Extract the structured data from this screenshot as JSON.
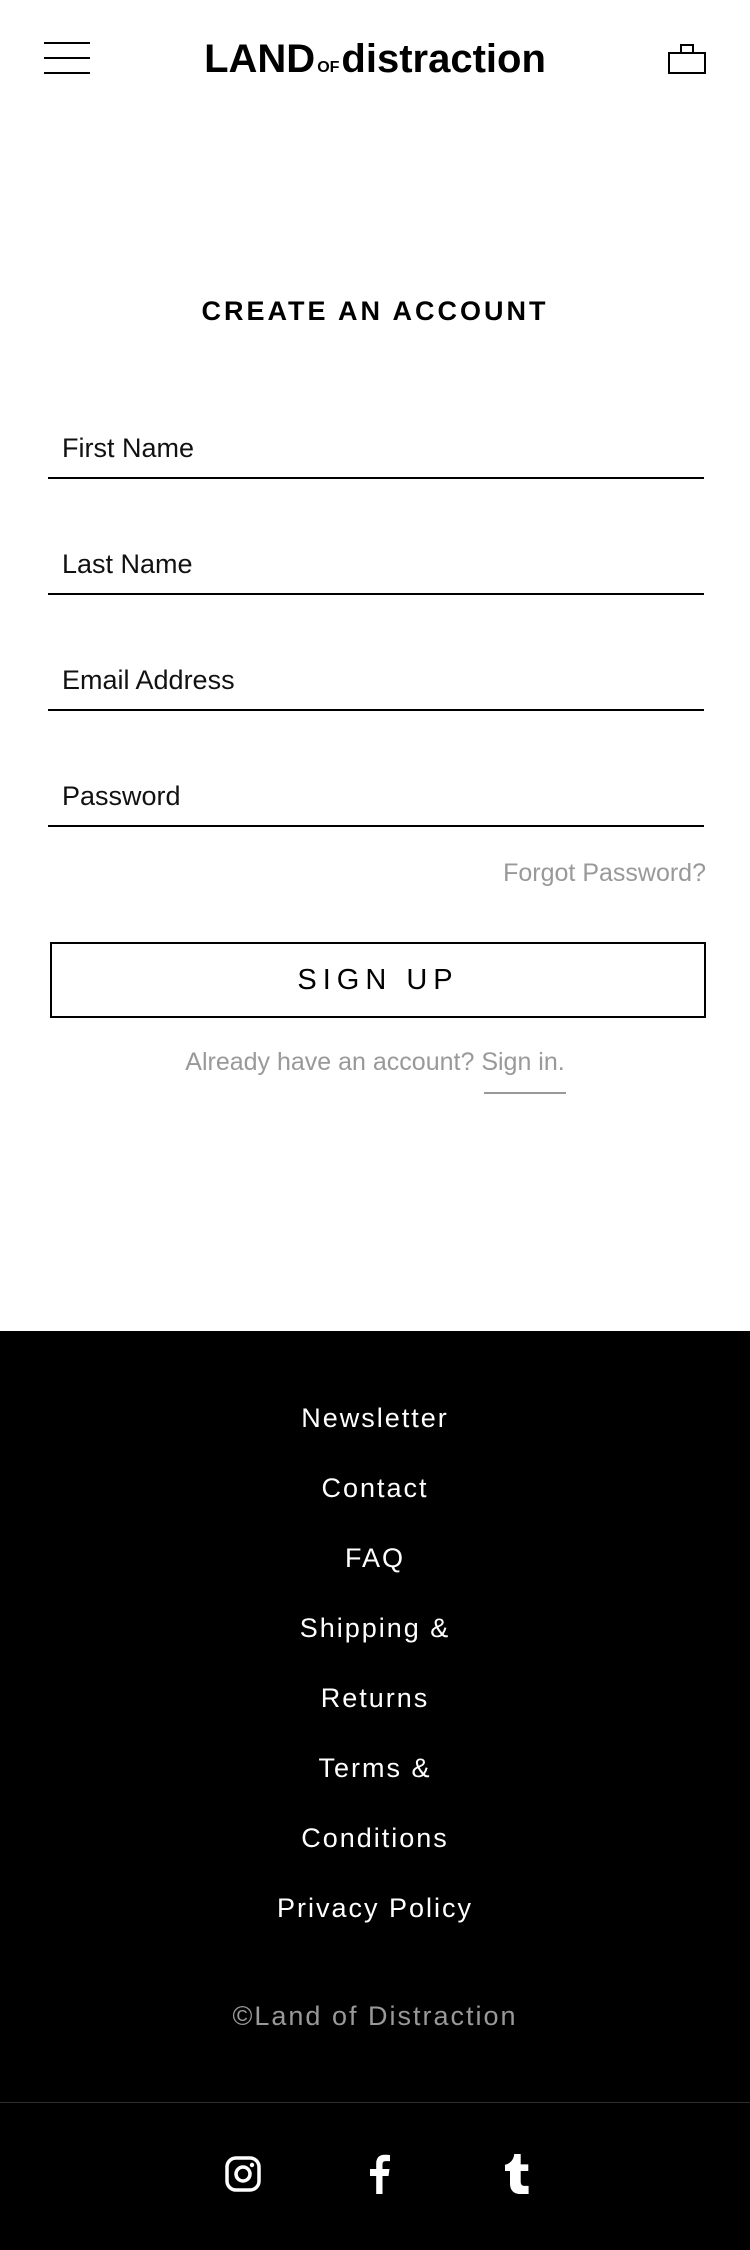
{
  "header": {
    "logo_big_1": "LAND",
    "logo_small": "OF",
    "logo_big_2": "distraction",
    "menu_icon": "hamburger-menu-icon",
    "cart_icon": "shopping-bag-icon"
  },
  "form": {
    "title": "CREATE AN ACCOUNT",
    "first_name_placeholder": "First Name",
    "last_name_placeholder": "Last Name",
    "email_placeholder": "Email Address",
    "password_placeholder": "Password",
    "forgot_password": "Forgot Password?",
    "signup_label": "SIGN UP",
    "already_text": "Already have an account? ",
    "signin_link": "Sign in."
  },
  "footer": {
    "links": [
      {
        "label": "Newsletter"
      },
      {
        "label": "Contact"
      },
      {
        "label": "FAQ"
      },
      {
        "label": "Shipping &"
      },
      {
        "label": "Returns"
      },
      {
        "label": "Terms &"
      },
      {
        "label": "Conditions"
      },
      {
        "label": "Privacy Policy"
      }
    ],
    "copyright": "©Land of Distraction",
    "social_icons": [
      "instagram-icon",
      "facebook-icon",
      "tumblr-icon"
    ]
  },
  "colors": {
    "text": "#000000",
    "muted": "#999999",
    "footer_bg": "#000000",
    "footer_text": "#ffffff"
  }
}
